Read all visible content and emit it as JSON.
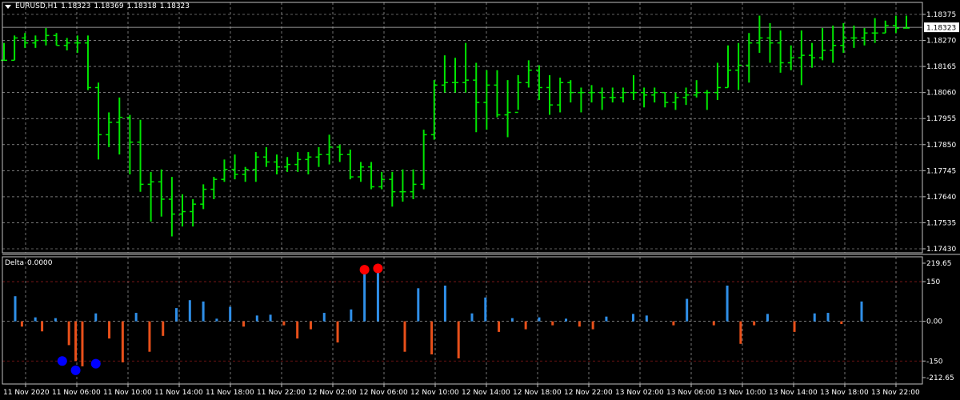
{
  "header": {
    "symbol": "EURUSD,H1",
    "open": "1.18323",
    "high": "1.18369",
    "low": "1.18318",
    "close": "1.18323"
  },
  "indicator": {
    "name": "Delta",
    "value": "0.0000"
  },
  "colors": {
    "background": "#000000",
    "bar": "#00e600",
    "grid": "#c0c0c0",
    "frame": "#c0c0c0",
    "delta_positive": "#2f8fe8",
    "delta_negative": "#e8501a",
    "level_line": "#8b1a1a",
    "signal_high": "#ff0000",
    "signal_low": "#0000ff",
    "text": "#ffffff"
  },
  "chart_data": [
    {
      "type": "ohlc",
      "price_axis": [
        "1.18375",
        "1.18270",
        "1.18165",
        "1.18060",
        "1.17955",
        "1.17850",
        "1.17745",
        "1.17640",
        "1.17535",
        "1.17430"
      ],
      "ylim": [
        1.1743,
        1.18375
      ],
      "current_price": "1.18323",
      "time_axis": [
        "11 Nov 2020",
        "11 Nov 06:00",
        "11 Nov 10:00",
        "11 Nov 14:00",
        "11 Nov 18:00",
        "11 Nov 22:00",
        "12 Nov 02:00",
        "12 Nov 06:00",
        "12 Nov 10:00",
        "12 Nov 14:00",
        "12 Nov 18:00",
        "12 Nov 22:00",
        "13 Nov 02:00",
        "13 Nov 06:00",
        "13 Nov 10:00",
        "13 Nov 14:00",
        "13 Nov 18:00",
        "13 Nov 22:00"
      ],
      "bars": [
        [
          1.1819,
          1.1826,
          1.1819,
          1.1819
        ],
        [
          1.1819,
          1.1829,
          1.1819,
          1.1828
        ],
        [
          1.1828,
          1.183,
          1.1824,
          1.1826
        ],
        [
          1.1826,
          1.1829,
          1.1824,
          1.1827
        ],
        [
          1.1827,
          1.1832,
          1.1825,
          1.1829
        ],
        [
          1.1829,
          1.183,
          1.1825,
          1.1825
        ],
        [
          1.1825,
          1.1828,
          1.1823,
          1.1826
        ],
        [
          1.1826,
          1.1829,
          1.1822,
          1.1826
        ],
        [
          1.1826,
          1.1829,
          1.1807,
          1.1808
        ],
        [
          1.1808,
          1.181,
          1.1779,
          1.1789
        ],
        [
          1.1789,
          1.1798,
          1.1784,
          1.1794
        ],
        [
          1.1794,
          1.1804,
          1.1781,
          1.1796
        ],
        [
          1.1796,
          1.1797,
          1.1773,
          1.1786
        ],
        [
          1.1786,
          1.1795,
          1.1766,
          1.1769
        ],
        [
          1.1769,
          1.1774,
          1.1754,
          1.177
        ],
        [
          1.177,
          1.1775,
          1.1756,
          1.1763
        ],
        [
          1.1763,
          1.1772,
          1.1748,
          1.1757
        ],
        [
          1.1757,
          1.1765,
          1.1752,
          1.1758
        ],
        [
          1.1758,
          1.1763,
          1.1752,
          1.1761
        ],
        [
          1.1761,
          1.1769,
          1.1759,
          1.1767
        ],
        [
          1.1767,
          1.1772,
          1.1763,
          1.1771
        ],
        [
          1.1771,
          1.1779,
          1.177,
          1.1775
        ],
        [
          1.1775,
          1.1781,
          1.1771,
          1.1773
        ],
        [
          1.1773,
          1.1776,
          1.177,
          1.1775
        ],
        [
          1.1775,
          1.1782,
          1.177,
          1.178
        ],
        [
          1.178,
          1.1784,
          1.1776,
          1.1778
        ],
        [
          1.1778,
          1.1781,
          1.1773,
          1.1776
        ],
        [
          1.1776,
          1.178,
          1.1774,
          1.1777
        ],
        [
          1.1777,
          1.1782,
          1.1774,
          1.1779
        ],
        [
          1.1779,
          1.1782,
          1.1773,
          1.178
        ],
        [
          1.178,
          1.1784,
          1.1776,
          1.1781
        ],
        [
          1.1781,
          1.1789,
          1.1777,
          1.1784
        ],
        [
          1.1784,
          1.1785,
          1.1778,
          1.1781
        ],
        [
          1.1781,
          1.1783,
          1.1771,
          1.1772
        ],
        [
          1.1772,
          1.1778,
          1.177,
          1.1776
        ],
        [
          1.1776,
          1.1778,
          1.1767,
          1.1768
        ],
        [
          1.1768,
          1.1774,
          1.1767,
          1.1771
        ],
        [
          1.1771,
          1.1774,
          1.176,
          1.1766
        ],
        [
          1.1766,
          1.1775,
          1.1762,
          1.1766
        ],
        [
          1.1766,
          1.1775,
          1.1763,
          1.1769
        ],
        [
          1.1769,
          1.1791,
          1.1767,
          1.1789
        ],
        [
          1.1789,
          1.1811,
          1.1787,
          1.1809
        ],
        [
          1.1809,
          1.1821,
          1.1806,
          1.181
        ],
        [
          1.181,
          1.182,
          1.1806,
          1.181
        ],
        [
          1.181,
          1.1826,
          1.1806,
          1.1811
        ],
        [
          1.1811,
          1.1818,
          1.179,
          1.1802
        ],
        [
          1.1802,
          1.1815,
          1.1791,
          1.1809
        ],
        [
          1.1809,
          1.1815,
          1.1796,
          1.1797
        ],
        [
          1.1797,
          1.1811,
          1.1788,
          1.1798
        ],
        [
          1.1798,
          1.1813,
          1.1799,
          1.181
        ],
        [
          1.181,
          1.1819,
          1.1808,
          1.1815
        ],
        [
          1.1815,
          1.1817,
          1.1803,
          1.1808
        ],
        [
          1.1808,
          1.1813,
          1.1797,
          1.1801
        ],
        [
          1.1801,
          1.1812,
          1.1798,
          1.181
        ],
        [
          1.181,
          1.1811,
          1.1802,
          1.1806
        ],
        [
          1.1806,
          1.1808,
          1.1798,
          1.1806
        ],
        [
          1.1806,
          1.1809,
          1.1802,
          1.1806
        ],
        [
          1.1806,
          1.1808,
          1.1799,
          1.1804
        ],
        [
          1.1804,
          1.1808,
          1.1802,
          1.1804
        ],
        [
          1.1804,
          1.1808,
          1.1802,
          1.1806
        ],
        [
          1.1806,
          1.1813,
          1.1803,
          1.1806
        ],
        [
          1.1806,
          1.1808,
          1.18,
          1.1805
        ],
        [
          1.1805,
          1.1808,
          1.1802,
          1.1806
        ],
        [
          1.1806,
          1.1806,
          1.18,
          1.1802
        ],
        [
          1.1802,
          1.1806,
          1.1799,
          1.1804
        ],
        [
          1.1804,
          1.1808,
          1.1801,
          1.1805
        ],
        [
          1.1805,
          1.1811,
          1.1804,
          1.1806
        ],
        [
          1.1806,
          1.1807,
          1.1799,
          1.1806
        ],
        [
          1.1806,
          1.1818,
          1.1803,
          1.1808
        ],
        [
          1.1808,
          1.1825,
          1.1808,
          1.1815
        ],
        [
          1.1815,
          1.1826,
          1.1807,
          1.1817
        ],
        [
          1.1817,
          1.183,
          1.181,
          1.1826
        ],
        [
          1.1826,
          1.1837,
          1.1822,
          1.1828
        ],
        [
          1.1828,
          1.1834,
          1.1818,
          1.1826
        ],
        [
          1.1826,
          1.1831,
          1.1814,
          1.1818
        ],
        [
          1.1818,
          1.1825,
          1.1815,
          1.182
        ],
        [
          1.182,
          1.1831,
          1.1809,
          1.1821
        ],
        [
          1.1821,
          1.1826,
          1.1816,
          1.182
        ],
        [
          1.182,
          1.1832,
          1.1819,
          1.1823
        ],
        [
          1.1823,
          1.1833,
          1.1818,
          1.1825
        ],
        [
          1.1825,
          1.1834,
          1.1822,
          1.1828
        ],
        [
          1.1828,
          1.1833,
          1.1824,
          1.1828
        ],
        [
          1.1828,
          1.1832,
          1.1825,
          1.183
        ],
        [
          1.183,
          1.1836,
          1.1826,
          1.183
        ],
        [
          1.183,
          1.1835,
          1.183,
          1.1833
        ],
        [
          1.1833,
          1.1837,
          1.183,
          1.1832
        ],
        [
          1.1832,
          1.1837,
          1.1832,
          1.1832
        ]
      ]
    },
    {
      "type": "bar",
      "title": "Delta 0.0000",
      "axis_labels": [
        "219.65",
        "150",
        "0.00",
        "-150",
        "-212.65"
      ],
      "ylim": [
        -212.65,
        219.65
      ],
      "levels": [
        150,
        -150
      ],
      "values": [
        95,
        -20,
        0,
        15,
        -38,
        0,
        12,
        0,
        -90,
        -150,
        -170,
        0,
        30,
        0,
        -65,
        0,
        -155,
        0,
        32,
        0,
        -115,
        0,
        -55,
        0,
        50,
        0,
        80,
        0,
        75,
        0,
        10,
        0,
        55,
        0,
        -20,
        0,
        22,
        0,
        25,
        0,
        -15,
        0,
        -65,
        0,
        -30,
        0,
        32,
        0,
        -80,
        0,
        45,
        0,
        190,
        0,
        195,
        0,
        0,
        0,
        -115,
        0,
        125,
        0,
        -125,
        0,
        135,
        0,
        -140,
        0,
        30,
        0,
        90,
        0,
        -40,
        0,
        12,
        0,
        -30,
        0,
        15,
        0,
        -15,
        0,
        10,
        0,
        -20,
        0,
        -30,
        0,
        18,
        0,
        0,
        0,
        28,
        0,
        22,
        0,
        0,
        0,
        -15,
        0,
        85,
        0,
        0,
        0,
        -15,
        0,
        135,
        0,
        -85,
        0,
        -15,
        0,
        28,
        0,
        0,
        0,
        -40,
        0,
        0,
        30,
        0,
        32,
        0,
        -10,
        0,
        0,
        75
      ],
      "signals": [
        {
          "index": 52,
          "value": 195,
          "kind": "high"
        },
        {
          "index": 54,
          "value": 200,
          "kind": "high"
        },
        {
          "index": 7,
          "value": -150,
          "kind": "low"
        },
        {
          "index": 9,
          "value": -185,
          "kind": "low"
        },
        {
          "index": 12,
          "value": -160,
          "kind": "low"
        }
      ]
    }
  ]
}
